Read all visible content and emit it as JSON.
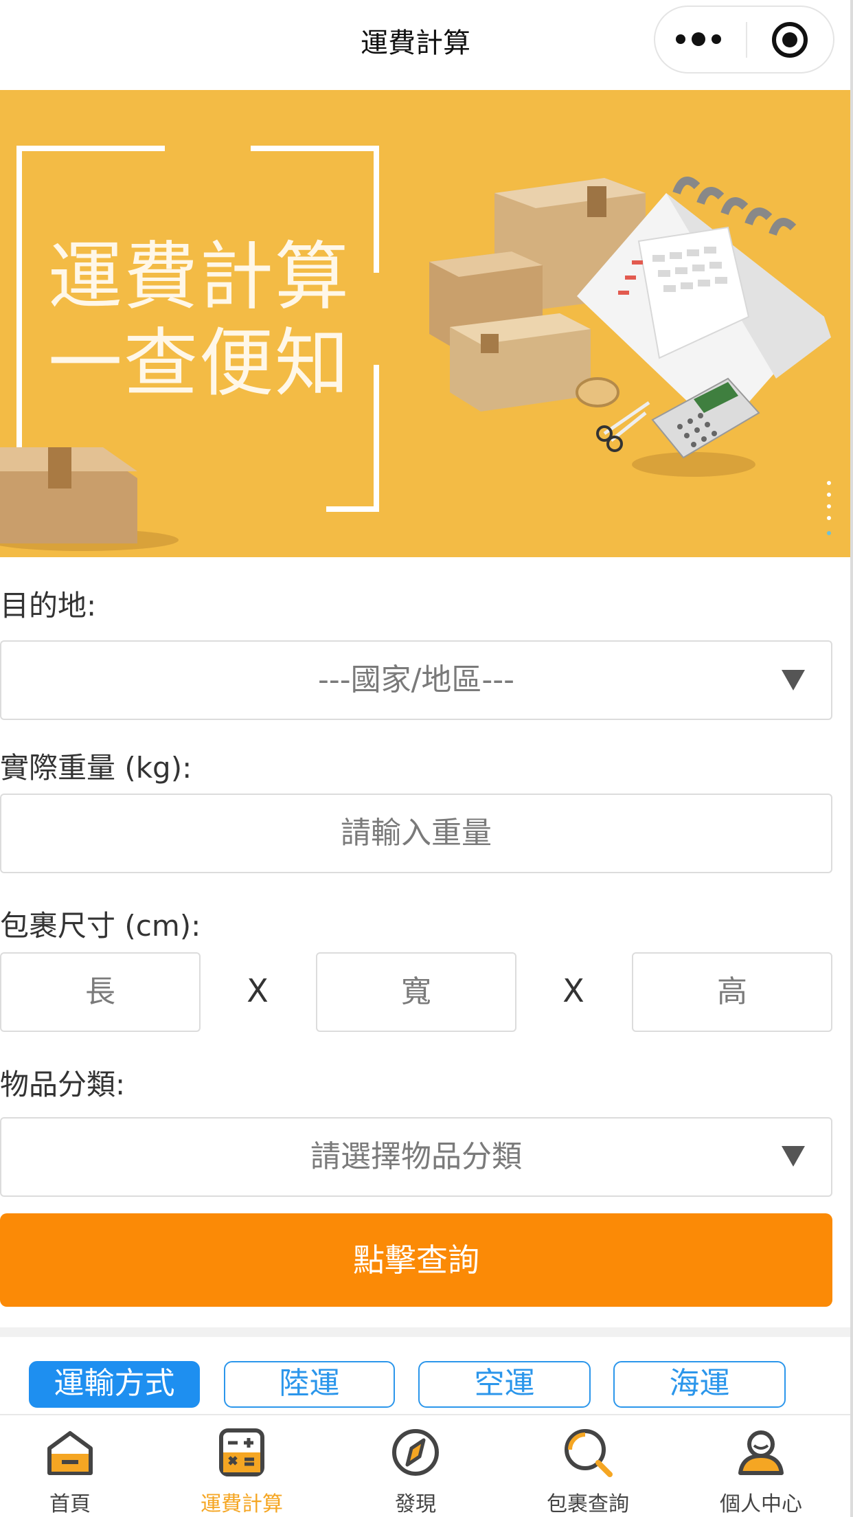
{
  "navbar": {
    "title": "運費計算"
  },
  "banner": {
    "line1": "運費計算",
    "line2": "一查便知"
  },
  "form": {
    "destination_label": "目的地:",
    "destination_value": "---國家/地區---",
    "weight_label": "實際重量 (kg):",
    "weight_placeholder": "請輸入重量",
    "size_label": "包裹尺寸 (cm):",
    "length_placeholder": "長",
    "width_placeholder": "寬",
    "height_placeholder": "高",
    "times_symbol": "X",
    "category_label": "物品分類:",
    "category_value": "請選擇物品分類",
    "query_button": "點擊查詢"
  },
  "transport": {
    "label": "運輸方式",
    "options": [
      "陸運",
      "空運",
      "海運"
    ]
  },
  "tabbar": {
    "items": [
      {
        "label": "首頁",
        "icon": "home-icon",
        "active": false
      },
      {
        "label": "運費計算",
        "icon": "calculator-icon",
        "active": true
      },
      {
        "label": "發現",
        "icon": "compass-icon",
        "active": false
      },
      {
        "label": "包裹查詢",
        "icon": "search-icon",
        "active": false
      },
      {
        "label": "個人中心",
        "icon": "user-icon",
        "active": false
      }
    ]
  },
  "colors": {
    "banner_bg": "#f3bb45",
    "primary_button": "#fb8a06",
    "accent_blue": "#1e8ff0",
    "active_tab": "#f5a623"
  }
}
